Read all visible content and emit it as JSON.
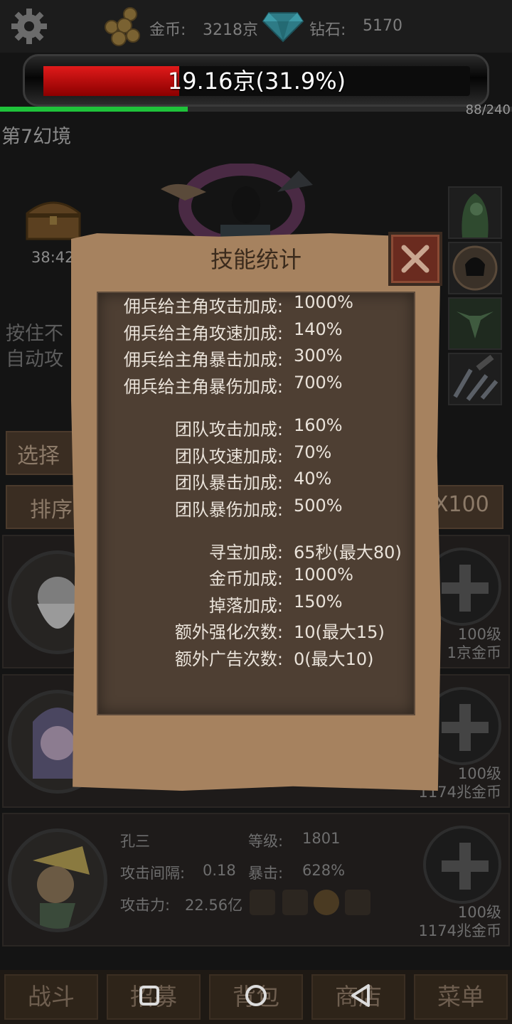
{
  "topbar": {
    "gold_label": "金币:",
    "gold_value": "3218京",
    "diamond_label": "钻石:",
    "diamond_value": "5170"
  },
  "boss_hp": {
    "text": "19.16京(31.9%)",
    "fraction": 0.319
  },
  "wave": {
    "count": "88/240",
    "fraction": 0.3667
  },
  "stage_label": "第7幻境",
  "chest_timer": "38:42",
  "hint_text": [
    "按住不",
    "自动攻"
  ],
  "buttons_bg": {
    "select": "选择",
    "sort": "排序",
    "x100": "X100"
  },
  "heroes": [
    {
      "level_btn": "100级",
      "cost": "1京金币"
    },
    {
      "level_btn": "100级",
      "cost": "1174兆金币"
    },
    {
      "name": "孔三",
      "level_label": "等级:",
      "level": "1801",
      "interval_label": "攻击间隔:",
      "interval": "0.18",
      "crit_label": "暴击:",
      "crit": "628%",
      "attack_label": "攻击力:",
      "attack": "22.56亿",
      "level_btn": "100级",
      "cost": "1174兆金币"
    }
  ],
  "bottom_nav": [
    "战斗",
    "招募",
    "背包",
    "商店",
    "菜单"
  ],
  "modal": {
    "title": "技能统计",
    "rows": [
      {
        "label": "佣兵给主角攻击加成:",
        "value": "1000%"
      },
      {
        "label": "佣兵给主角攻速加成:",
        "value": "140%"
      },
      {
        "label": "佣兵给主角暴击加成:",
        "value": "300%"
      },
      {
        "label": "佣兵给主角暴伤加成:",
        "value": "700%"
      },
      {
        "label": "团队攻击加成:",
        "value": "160%"
      },
      {
        "label": "团队攻速加成:",
        "value": "70%"
      },
      {
        "label": "团队暴击加成:",
        "value": "40%"
      },
      {
        "label": "团队暴伤加成:",
        "value": "500%"
      },
      {
        "label": "寻宝加成:",
        "value": "65秒(最大80)"
      },
      {
        "label": "金币加成:",
        "value": "1000%"
      },
      {
        "label": "掉落加成:",
        "value": "150%"
      },
      {
        "label": "额外强化次数:",
        "value": "10(最大15)"
      },
      {
        "label": "额外广告次数:",
        "value": "0(最大10)"
      }
    ]
  },
  "colors": {
    "hp": "#d01515",
    "wave": "#1fc23a",
    "parchment": "#a6825f",
    "close": "#6a2b1f"
  }
}
